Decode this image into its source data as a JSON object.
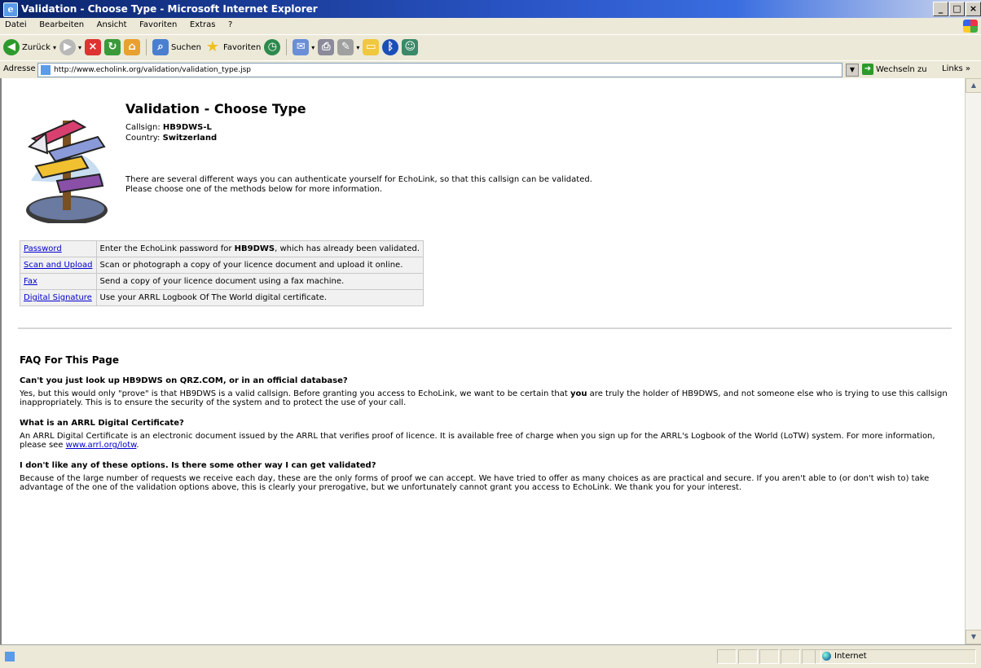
{
  "window": {
    "title": "Validation - Choose Type - Microsoft Internet Explorer",
    "controls": [
      "_",
      "□",
      "×"
    ]
  },
  "menu": [
    "Datei",
    "Bearbeiten",
    "Ansicht",
    "Favoriten",
    "Extras",
    "?"
  ],
  "toolbar": {
    "back_label": "Zurück",
    "search_label": "Suchen",
    "favorites_label": "Favoriten"
  },
  "address": {
    "label": "Adresse",
    "url": "http://www.echolink.org/validation/validation_type.jsp",
    "go_label": "Wechseln zu",
    "links_label": "Links"
  },
  "page": {
    "heading": "Validation - Choose Type",
    "callsign_label": "Callsign:",
    "callsign": "HB9DWS-L",
    "country_label": "Country:",
    "country": "Switzerland",
    "intro_line1": "There are several different ways you can authenticate yourself for EchoLink, so that this callsign can be validated.",
    "intro_line2": "Please choose one of the methods below for more information.",
    "methods": [
      {
        "link": "Password",
        "desc_pre": "Enter the EchoLink password for ",
        "desc_bold": "HB9DWS",
        "desc_post": ", which has already been validated."
      },
      {
        "link": "Scan and Upload",
        "desc": "Scan or photograph a copy of your licence document and upload it online."
      },
      {
        "link": "Fax",
        "desc": "Send a copy of your licence document using a fax machine."
      },
      {
        "link": "Digital Signature",
        "desc": "Use your ARRL Logbook Of The World digital certificate."
      }
    ],
    "faq_title": "FAQ For This Page",
    "faq": [
      {
        "q": "Can't you just look up HB9DWS on QRZ.COM, or in an official database?",
        "a_pre": "Yes, but this would only \"prove\" is that HB9DWS is a valid callsign. Before granting you access to EchoLink, we want to be certain that ",
        "a_bold": "you",
        "a_post": " are truly the holder of HB9DWS, and not someone else who is trying to use this callsign inappropriately. This is to ensure the security of the system and to protect the use of your call."
      },
      {
        "q": "What is an ARRL Digital Certificate?",
        "a_pre": "An ARRL Digital Certificate is an electronic document issued by the ARRL that verifies proof of licence. It is available free of charge when you sign up for the ARRL's Logbook of the World (LoTW) system. For more information, please see ",
        "a_link": "www.arrl.org/lotw",
        "a_post": "."
      },
      {
        "q": "I don't like any of these options. Is there some other way I can get validated?",
        "a": "Because of the large number of requests we receive each day, these are the only forms of proof we can accept. We have tried to offer as many choices as are practical and secure. If you aren't able to (or don't wish to) take advantage of the one of the validation options above, this is clearly your prerogative, but we unfortunately cannot grant you access to EchoLink. We thank you for your interest."
      }
    ]
  },
  "status": {
    "zone": "Internet"
  }
}
